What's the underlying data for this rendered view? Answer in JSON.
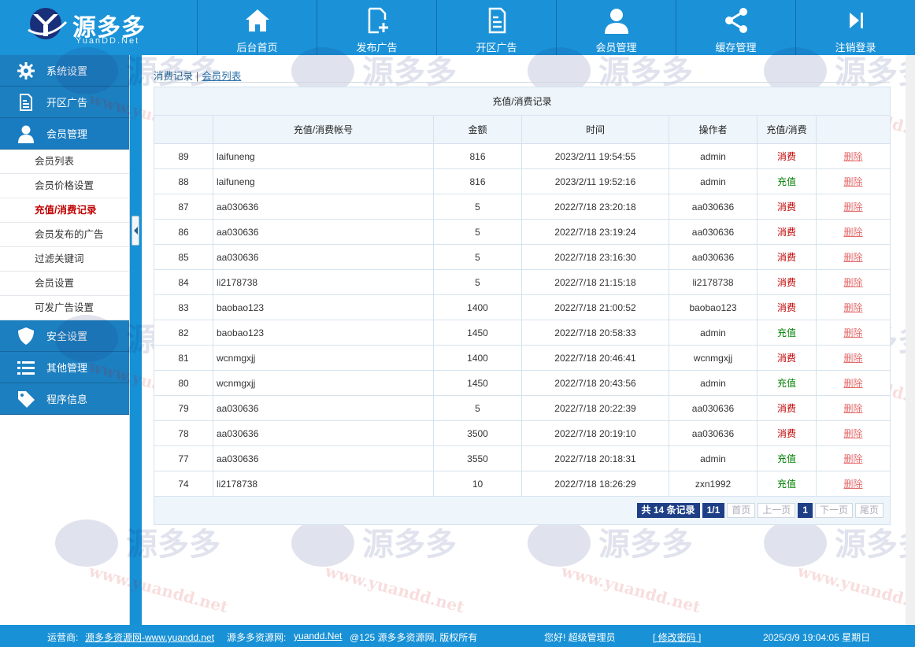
{
  "logo": {
    "name": "源多多",
    "sub": "YuanDD.Net"
  },
  "nav": [
    {
      "label": "后台首页",
      "icon": "home-icon"
    },
    {
      "label": "发布广告",
      "icon": "document-plus-icon"
    },
    {
      "label": "开区广告",
      "icon": "document-icon"
    },
    {
      "label": "会员管理",
      "icon": "user-icon"
    },
    {
      "label": "缓存管理",
      "icon": "share-icon"
    },
    {
      "label": "注销登录",
      "icon": "skip-forward-icon"
    }
  ],
  "sidebar": {
    "sections": [
      {
        "label": "系统设置",
        "icon": "gear-icon"
      },
      {
        "label": "开区广告",
        "icon": "document-icon"
      },
      {
        "label": "会员管理",
        "icon": "user-icon"
      }
    ],
    "sub_items": [
      "会员列表",
      "会员价格设置",
      "充值/消费记录",
      "会员发布的广告",
      "过滤关键词",
      "会员设置",
      "可发广告设置"
    ],
    "sections_after": [
      {
        "label": "安全设置",
        "icon": "shield-icon"
      },
      {
        "label": "其他管理",
        "icon": "list-icon"
      },
      {
        "label": "程序信息",
        "icon": "tag-icon"
      }
    ]
  },
  "breadcrumb": {
    "current": "消费记录",
    "sep": "|",
    "link": "会员列表"
  },
  "table": {
    "caption": "充值/消费记录",
    "headers": [
      "",
      "充值/消费帐号",
      "金额",
      "时间",
      "操作者",
      "充值/消费",
      ""
    ],
    "delete_label": "删除",
    "rows": [
      {
        "id": "89",
        "account": "laifuneng",
        "amount": "816",
        "time": "2023/2/11 19:54:55",
        "operator": "admin",
        "type": "消费"
      },
      {
        "id": "88",
        "account": "laifuneng",
        "amount": "816",
        "time": "2023/2/11 19:52:16",
        "operator": "admin",
        "type": "充值"
      },
      {
        "id": "87",
        "account": "aa030636",
        "amount": "5",
        "time": "2022/7/18 23:20:18",
        "operator": "aa030636",
        "type": "消费"
      },
      {
        "id": "86",
        "account": "aa030636",
        "amount": "5",
        "time": "2022/7/18 23:19:24",
        "operator": "aa030636",
        "type": "消费"
      },
      {
        "id": "85",
        "account": "aa030636",
        "amount": "5",
        "time": "2022/7/18 23:16:30",
        "operator": "aa030636",
        "type": "消费"
      },
      {
        "id": "84",
        "account": "li2178738",
        "amount": "5",
        "time": "2022/7/18 21:15:18",
        "operator": "li2178738",
        "type": "消费"
      },
      {
        "id": "83",
        "account": "baobao123",
        "amount": "1400",
        "time": "2022/7/18 21:00:52",
        "operator": "baobao123",
        "type": "消费"
      },
      {
        "id": "82",
        "account": "baobao123",
        "amount": "1450",
        "time": "2022/7/18 20:58:33",
        "operator": "admin",
        "type": "充值"
      },
      {
        "id": "81",
        "account": "wcnmgxjj",
        "amount": "1400",
        "time": "2022/7/18 20:46:41",
        "operator": "wcnmgxjj",
        "type": "消费"
      },
      {
        "id": "80",
        "account": "wcnmgxjj",
        "amount": "1450",
        "time": "2022/7/18 20:43:56",
        "operator": "admin",
        "type": "充值"
      },
      {
        "id": "79",
        "account": "aa030636",
        "amount": "5",
        "time": "2022/7/18 20:22:39",
        "operator": "aa030636",
        "type": "消费"
      },
      {
        "id": "78",
        "account": "aa030636",
        "amount": "3500",
        "time": "2022/7/18 20:19:10",
        "operator": "aa030636",
        "type": "消费"
      },
      {
        "id": "77",
        "account": "aa030636",
        "amount": "3550",
        "time": "2022/7/18 20:18:31",
        "operator": "admin",
        "type": "充值"
      },
      {
        "id": "74",
        "account": "li2178738",
        "amount": "10",
        "time": "2022/7/18 18:26:29",
        "operator": "zxn1992",
        "type": "充值"
      }
    ]
  },
  "pager": {
    "total": "共 14 条记录",
    "pages": "1/1",
    "first": "首页",
    "prev": "上一页",
    "current": "1",
    "next": "下一页",
    "last": "尾页"
  },
  "footer": {
    "operator_label": "运营商:",
    "operator_link": "源多多资源网-www.yuandd.net",
    "site_label": "源多多资源网:",
    "site_link": "yuandd.Net",
    "copyright": "@125 源多多资源网, 版权所有",
    "greeting": "您好! 超级管理员",
    "change_pwd": "[ 修改密码 ]",
    "datetime": "2025/3/9 19:04:05 星期日"
  },
  "watermark": {
    "text": "源多多",
    "sub": "YuanDD.Net",
    "url": "www.yuandd.net"
  },
  "colors": {
    "header": "#1a8fd3",
    "sidebar_head": "#1c7fc0",
    "consume": "#c00000",
    "recharge": "#008000",
    "delete": "#e46a6a",
    "pager_active": "#1e3f86"
  }
}
